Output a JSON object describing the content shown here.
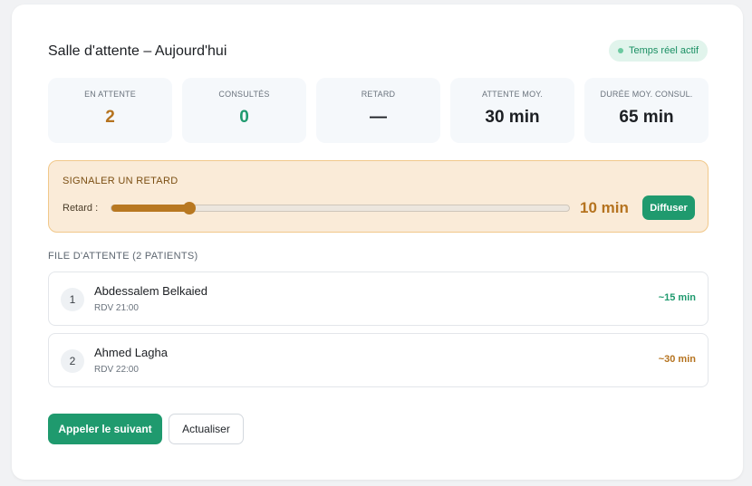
{
  "header": {
    "title": "Salle d'attente – Aujourd'hui",
    "live_badge": "Temps réel actif"
  },
  "stats": [
    {
      "label": "EN ATTENTE",
      "value": "2",
      "color": "#b5731f"
    },
    {
      "label": "CONSULTÉS",
      "value": "0",
      "color": "#1f9a6e"
    },
    {
      "label": "RETARD",
      "value": "—",
      "color": "#1c1f23"
    },
    {
      "label": "ATTENTE MOY.",
      "value": "30 min",
      "color": "#1c1f23"
    },
    {
      "label": "DURÉE MOY. CONSUL.",
      "value": "65 min",
      "color": "#1c1f23"
    }
  ],
  "delay": {
    "title": "SIGNALER UN RETARD",
    "label": "Retard :",
    "slider_fraction": 0.17,
    "value": "10 min",
    "button": "Diffuser"
  },
  "queue": {
    "title": "FILE D'ATTENTE (2 PATIENTS)",
    "patients": [
      {
        "num": "1",
        "name": "Abdessalem Belkaied",
        "rdv": "RDV 21:00",
        "eta": "~15 min",
        "eta_color": "#1f9a6e"
      },
      {
        "num": "2",
        "name": "Ahmed Lagha",
        "rdv": "RDV 22:00",
        "eta": "~30 min",
        "eta_color": "#b5731f"
      }
    ]
  },
  "actions": {
    "call_next": "Appeler le suivant",
    "refresh": "Actualiser"
  }
}
